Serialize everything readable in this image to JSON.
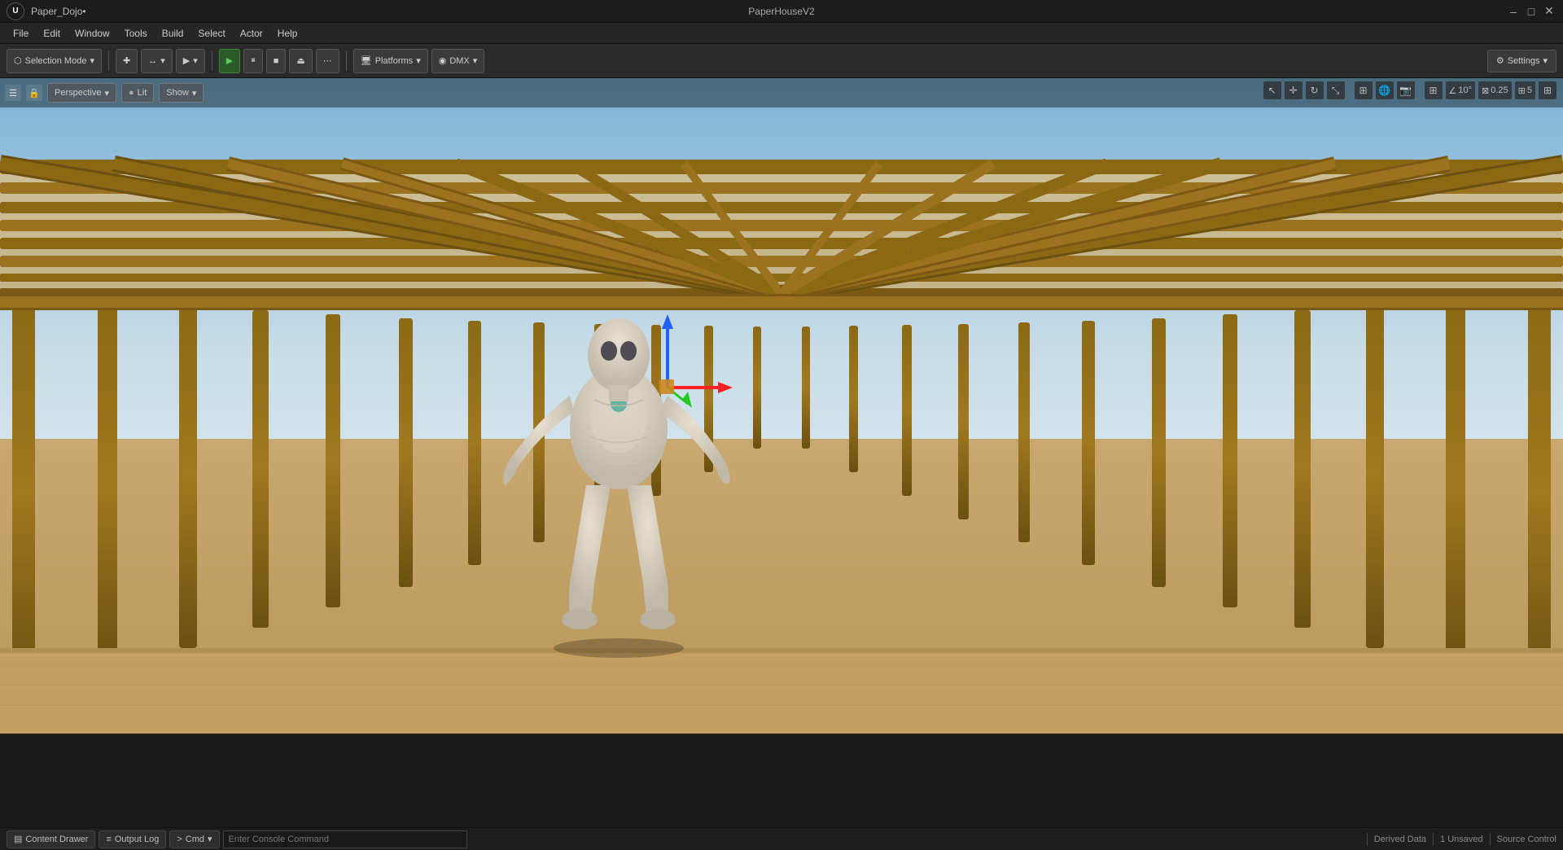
{
  "titleBar": {
    "projectName": "Paper_Dojo•",
    "windowTitle": "PaperHouseV2",
    "buttons": {
      "minimize": "–",
      "maximize": "□",
      "close": "✕"
    }
  },
  "menuBar": {
    "items": [
      "File",
      "Edit",
      "Window",
      "Tools",
      "Build",
      "Select",
      "Actor",
      "Help"
    ]
  },
  "toolbar": {
    "selectionMode": "Selection Mode",
    "platforms": "Platforms",
    "dmx": "DMX",
    "settings": "Settings"
  },
  "viewport": {
    "perspective": "Perspective",
    "lit": "Lit",
    "show": "Show",
    "angle": "10°",
    "scale": "0.25",
    "num": "5"
  },
  "statusBar": {
    "contentDrawer": "Content Drawer",
    "outputLog": "Output Log",
    "cmd": "Cmd",
    "consolePlaceholder": "Enter Console Command",
    "derivedData": "Derived Data",
    "unsaved": "1 Unsaved",
    "sourceControl": "Source Control"
  }
}
